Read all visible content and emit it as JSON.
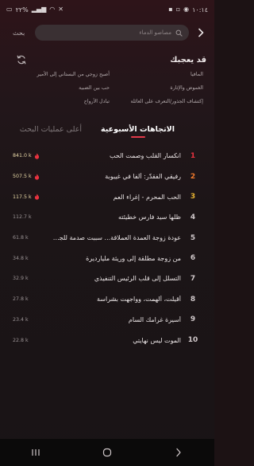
{
  "status_bar": {
    "time": "١٠:١٤",
    "battery": "٢٢%"
  },
  "search": {
    "button_label": "بحث",
    "placeholder": "مصاصو الدماء"
  },
  "suggestions": {
    "title": "قد يعجبك",
    "items": [
      "أصبح زوجي من البستاني إلى الأمير",
      "المافيا",
      "الغموض والإثارة",
      "حب بين الضبية",
      "تبادل الأرواح",
      "إكتشاف الجذور/التعرف على العائلة"
    ]
  },
  "tabs": [
    {
      "label": "الاتجاهات الأسبوعية",
      "active": true
    },
    {
      "label": "أعلى عمليات البحث",
      "active": false
    }
  ],
  "trending": [
    {
      "rank": "1",
      "title": "انكسار القلب وصمت الحب",
      "count": "841.0 k",
      "hot": true
    },
    {
      "rank": "2",
      "title": "رفيقي الفقدّر: ألفا في غيبوبة",
      "count": "507.5 k",
      "hot": true
    },
    {
      "rank": "3",
      "title": "الحب المحرم - إغراء العم",
      "count": "117.5 k",
      "hot": true
    },
    {
      "rank": "4",
      "title": "ظلها سيد فارس خطيئته",
      "count": "112.7 k",
      "hot": false
    },
    {
      "rank": "5",
      "title": "عودة زوجة العمدة العملاقة... سببت صدمة للجميع!",
      "count": "61.8 k",
      "hot": false
    },
    {
      "rank": "6",
      "title": "من زوجة مطلقة إلى وريثة مليارديرة",
      "count": "34.8 k",
      "hot": false
    },
    {
      "rank": "7",
      "title": "التسلل إلى قلب الرئيس التنفيذي",
      "count": "32.9 k",
      "hot": false
    },
    {
      "rank": "8",
      "title": "أقيلت، ألهمت، وواجهت بشراسة",
      "count": "27.8 k",
      "hot": false
    },
    {
      "rank": "9",
      "title": "أسيرة غرامك السام",
      "count": "23.4 k",
      "hot": false
    },
    {
      "rank": "10",
      "title": "الموت ليس نهايتي",
      "count": "22.8 k",
      "hot": false
    }
  ],
  "colors": {
    "accent": "#e23a4a",
    "rank1": "#e8323f",
    "rank2": "#f07a2c",
    "rank3": "#e7b332"
  }
}
